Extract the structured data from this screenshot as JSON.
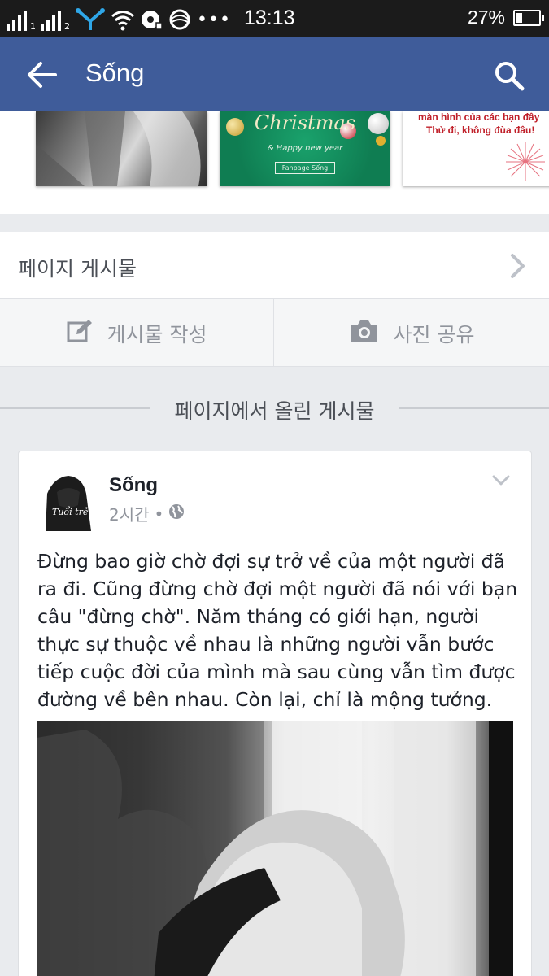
{
  "status_bar": {
    "sim1_label": "1",
    "sim2_label": "2",
    "time": "13:13",
    "battery_percent": "27%",
    "battery_level": 0.27,
    "icons": [
      "signal-sim1-icon",
      "signal-sim2-icon",
      "network-activity-icon",
      "wifi-icon",
      "nfc-icon",
      "sync-icon",
      "more-dots-icon",
      "battery-icon"
    ]
  },
  "app_bar": {
    "title": "Sống",
    "background": "#3f5c9a",
    "back_icon": "arrow-left-icon",
    "search_icon": "search-icon"
  },
  "photo_strip": {
    "christmas_title": "Christmas",
    "christmas_subtitle": "& Happy new year",
    "fanpage_label": "Fanpage Sống",
    "promo_line1": "màn hình của các bạn đây",
    "promo_line2": "Thử đi, không đùa đâu!"
  },
  "page_posts_row": {
    "label": "페이지 게시물",
    "chevron_icon": "chevron-right-icon"
  },
  "actions": {
    "write_post_label": "게시물 작성",
    "write_post_icon": "edit-icon",
    "share_photo_label": "사진 공유",
    "share_photo_icon": "camera-icon"
  },
  "section": {
    "title": "페이지에서 올린 게시물"
  },
  "post": {
    "author": "Sống",
    "time": "2시간",
    "separator": "•",
    "privacy_icon": "globe-icon",
    "avatar_caption": "Tuổi trẻ",
    "text": "Đừng bao giờ chờ đợi sự trở về của một người đã ra đi. Cũng đừng chờ đợi một người đã nói với bạn câu \"đừng chờ\". Năm tháng có giới hạn, người thực sự thuộc về nhau là những người vẫn bước tiếp cuộc đời của mình mà sau cùng vẫn tìm được đường về bên nhau. Còn lại, chỉ là mộng tưởng.",
    "menu_icon": "chevron-down-icon"
  }
}
